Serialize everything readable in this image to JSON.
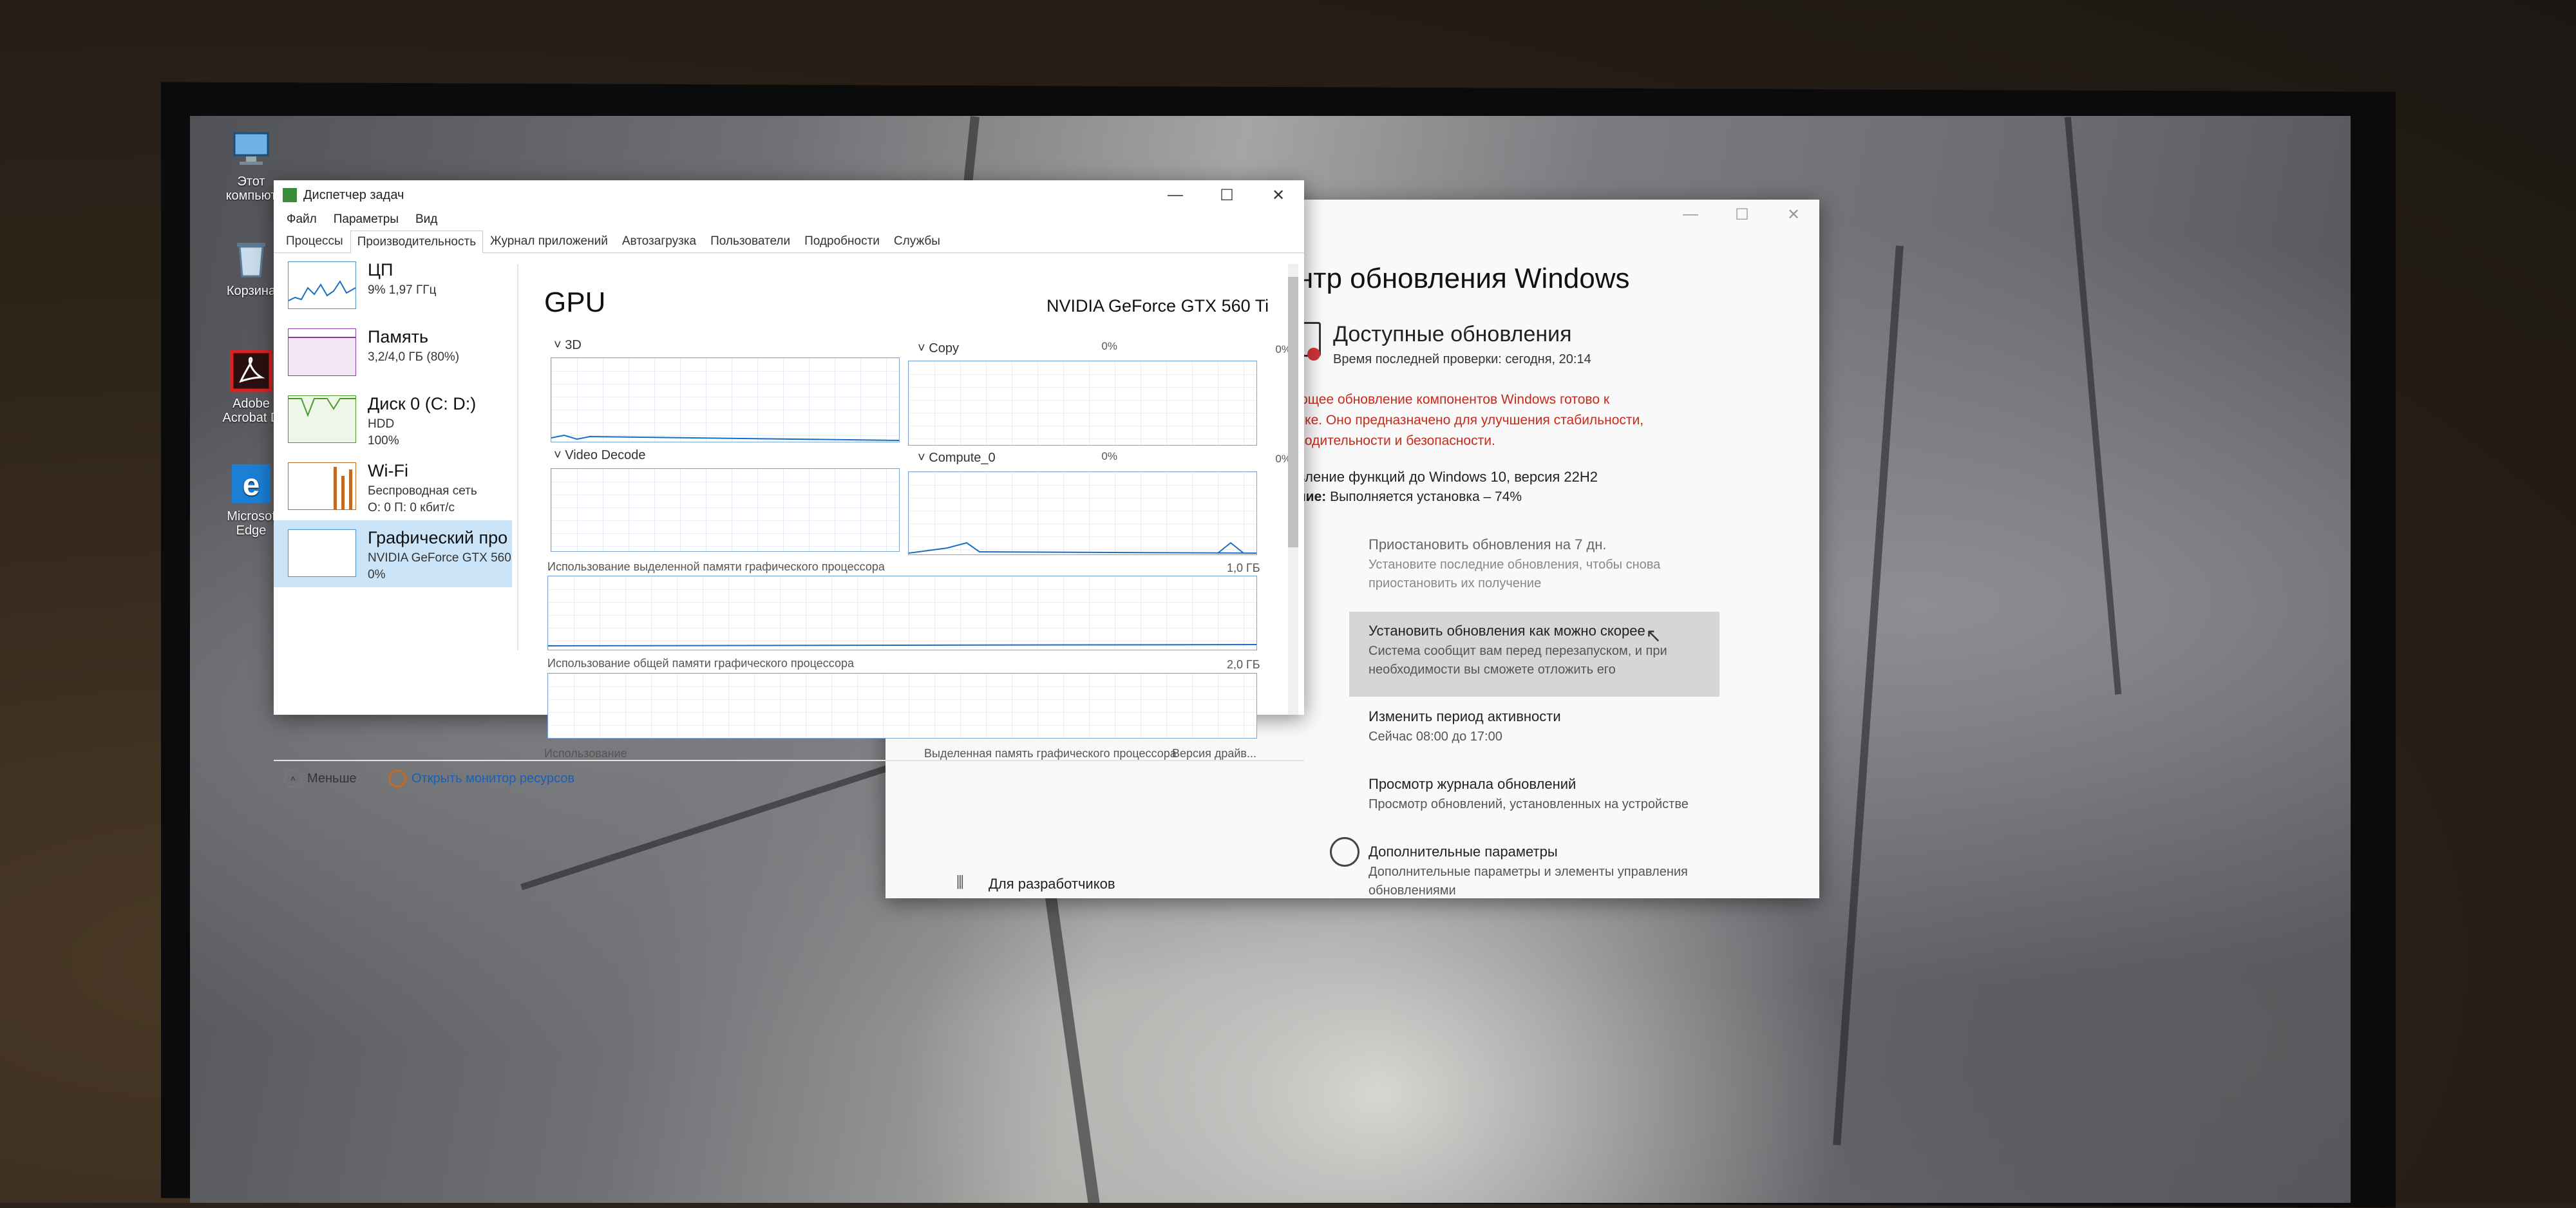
{
  "desktop": {
    "icons": [
      {
        "label": "Этот компьют",
        "icon": "computer-icon"
      },
      {
        "label": "Корзина",
        "icon": "recycle-bin-icon"
      },
      {
        "label": "Adobe Acrobat D",
        "icon": "acrobat-icon"
      },
      {
        "label": "Microsof Edge",
        "icon": "edge-icon"
      }
    ]
  },
  "taskmgr": {
    "title": "Диспетчер задач",
    "menu": [
      "Файл",
      "Параметры",
      "Вид"
    ],
    "tabs": [
      "Процессы",
      "Производительность",
      "Журнал приложений",
      "Автозагрузка",
      "Пользователи",
      "Подробности",
      "Службы"
    ],
    "active_tab": "Производительность",
    "sidebar": [
      {
        "name": "ЦП",
        "line1": "9% 1,97 ГГц",
        "line2": ""
      },
      {
        "name": "Память",
        "line1": "3,2/4,0 ГБ (80%)",
        "line2": ""
      },
      {
        "name": "Диск 0 (C: D:)",
        "line1": "HDD",
        "line2": "100%"
      },
      {
        "name": "Wi-Fi",
        "line1": "Беспроводная сеть",
        "line2": "О: 0 П: 0 кбит/с"
      },
      {
        "name": "Графический про",
        "line1": "NVIDIA GeForce GTX 560",
        "line2": "0%"
      }
    ],
    "gpu": {
      "title": "GPU",
      "model": "NVIDIA GeForce GTX 560 Ti",
      "engines": [
        {
          "name": "3D",
          "pct": "0%"
        },
        {
          "name": "Copy",
          "pct": "0%"
        },
        {
          "name": "Video Decode",
          "pct": "0%"
        },
        {
          "name": "Compute_0",
          "pct": "0%"
        }
      ],
      "dedicated_label": "Использование выделенной памяти графического процессора",
      "dedicated_max": "1,0 ГБ",
      "shared_label": "Использование общей памяти графического процессора",
      "shared_max": "2,0 ГБ",
      "footer_usage": "Использование",
      "footer_dedicated": "Выделенная память графического процессора",
      "footer_driver": "Версия драйв..."
    },
    "less_label": "Меньше",
    "resmon_label": "Открыть монитор ресурсов"
  },
  "update": {
    "title": "нтр обновления Windows",
    "available": "Доступные обновления",
    "last_check": "Время последней проверки: сегодня, 20:14",
    "warning_lines": [
      "ющее обновление компонентов Windows готово к",
      "вке. Оно предназначено для улучшения стабильности,",
      "водительности и безопасности."
    ],
    "feature_update": "вление функций до Windows 10, версия 22H2",
    "status_label": "ние:",
    "status_value": "Выполняется установка – 74%",
    "options": [
      {
        "title": "Приостановить обновления на 7 дн.",
        "desc1": "Установите последние обновления, чтобы снова",
        "desc2": "приостановить их получение"
      },
      {
        "title": "Установить обновления как можно скорее",
        "desc1": "Система сообщит вам перед перезапуском, и при",
        "desc2": "необходимости вы сможете отложить его"
      },
      {
        "title": "Изменить период активности",
        "desc1": "Сейчас 08:00 до 17:00",
        "desc2": ""
      },
      {
        "title": "Просмотр журнала обновлений",
        "desc1": "Просмотр обновлений, установленных на устройстве",
        "desc2": ""
      },
      {
        "title": "Дополнительные параметры",
        "desc1": "Дополнительные параметры и элементы управления",
        "desc2": "обновлениями"
      }
    ],
    "developer": "Для разработчиков"
  }
}
